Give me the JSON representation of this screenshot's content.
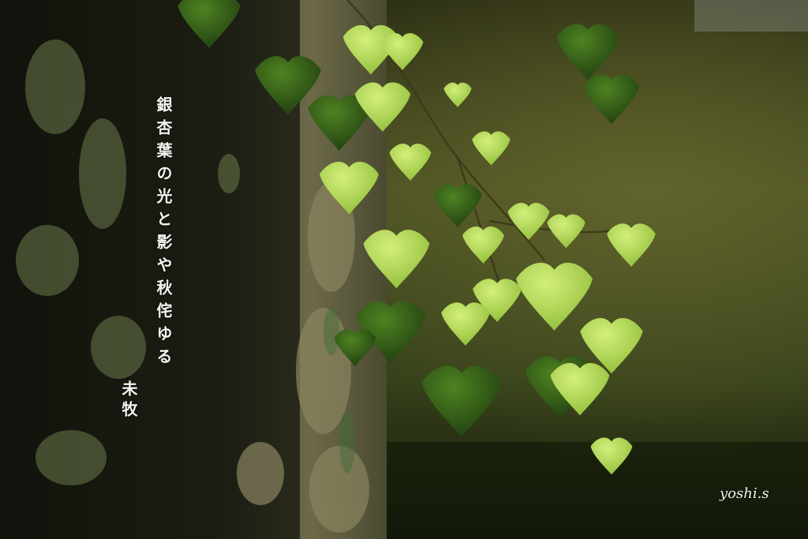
{
  "poem": {
    "text": "銀杏葉の光と影や秋侘ゆる",
    "author": "未牧"
  },
  "signature": "yoshi.s",
  "colors": {
    "leaf_bright": "#b9df5a",
    "leaf_mid": "#7fae2c",
    "leaf_dark": "#1f3a10",
    "background_green": "#3f4a1c",
    "bark": "#5a5a3a",
    "text": "#f4f4f0"
  }
}
